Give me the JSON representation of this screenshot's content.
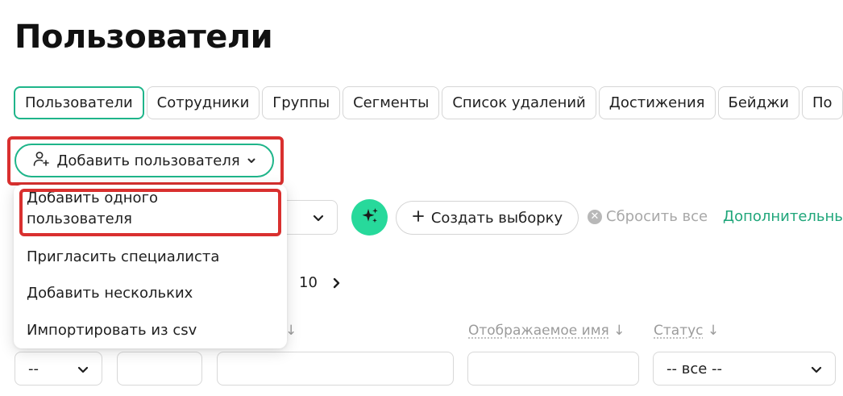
{
  "page": {
    "title": "Пользователи"
  },
  "tabs": [
    {
      "label": "Пользователи",
      "active": true
    },
    {
      "label": "Сотрудники"
    },
    {
      "label": "Группы"
    },
    {
      "label": "Сегменты"
    },
    {
      "label": "Список удалений"
    },
    {
      "label": "Достижения"
    },
    {
      "label": "Бейджи"
    },
    {
      "label": "По"
    }
  ],
  "add_user": {
    "label": "Добавить пользователя"
  },
  "menu": {
    "items": [
      {
        "label_line1": "Добавить одного",
        "label_line2": "пользователя"
      },
      {
        "label": "Пригласить специалиста"
      },
      {
        "label": "Добавить нескольких"
      },
      {
        "label": "Импортировать из csv"
      }
    ]
  },
  "filters": {
    "create_selection": "Создать выборку",
    "reset_all": "Сбросить все",
    "more": "Дополнительны"
  },
  "pagination": {
    "last_page": "10"
  },
  "columns": {
    "sort_arrow": "↓",
    "display_name": "Отображаемое имя",
    "status": "Статус"
  },
  "inputs": {
    "first_select_value": "--",
    "status_select_value": "-- все --"
  },
  "colors": {
    "accent": "#1fb58a",
    "ai_button": "#27d99b",
    "highlight": "#d9302f"
  },
  "icons": {
    "add_user": "user-plus-icon",
    "chevron": "chevron-down-icon",
    "ai": "sparkles-icon",
    "plus": "plus-icon",
    "reset": "close-circle-icon",
    "next": "chevron-right-icon"
  }
}
